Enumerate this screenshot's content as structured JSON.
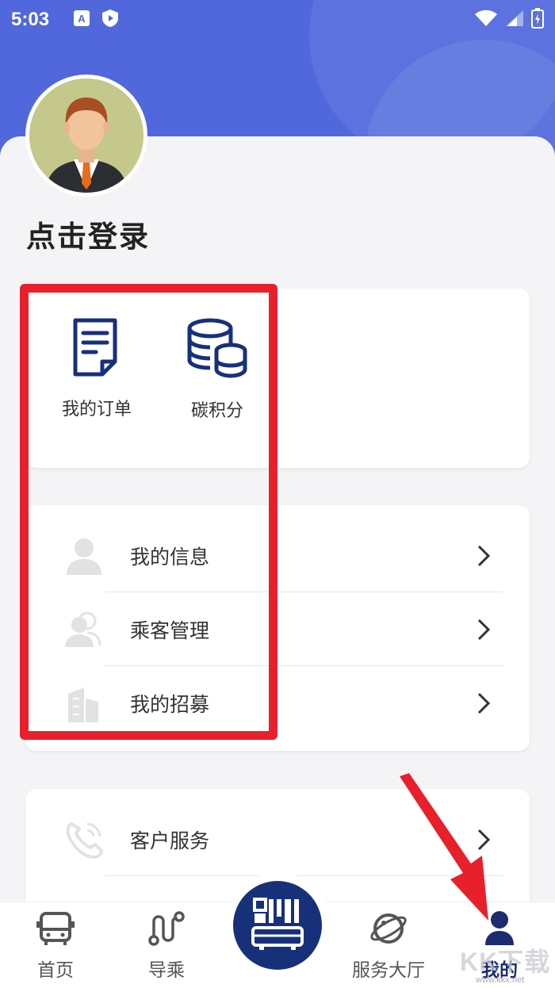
{
  "status_bar": {
    "time": "5:03"
  },
  "profile": {
    "login_prompt": "点击登录"
  },
  "quick_actions": [
    {
      "label": "我的订单",
      "icon": "order-document-icon"
    },
    {
      "label": "碳积分",
      "icon": "coin-stack-icon"
    }
  ],
  "menu_group1": [
    {
      "label": "我的信息",
      "icon": "user-icon"
    },
    {
      "label": "乘客管理",
      "icon": "passengers-icon"
    },
    {
      "label": "我的招募",
      "icon": "building-icon"
    }
  ],
  "menu_group2": [
    {
      "label": "客户服务",
      "icon": "phone-icon"
    }
  ],
  "tabbar": {
    "tabs": [
      {
        "label": "首页",
        "icon": "bus-icon"
      },
      {
        "label": "导乘",
        "icon": "route-icon"
      },
      {
        "label": "服务大厅",
        "icon": "planet-icon"
      },
      {
        "label": "我的",
        "icon": "profile-icon",
        "active": true
      }
    ],
    "center_icon": "qr-bus-icon"
  },
  "colors": {
    "header": "#5068dc",
    "primary": "#17307a",
    "annotation": "#e8202c"
  },
  "watermark": {
    "text": "KK下载",
    "url": "www.kkx.net"
  }
}
